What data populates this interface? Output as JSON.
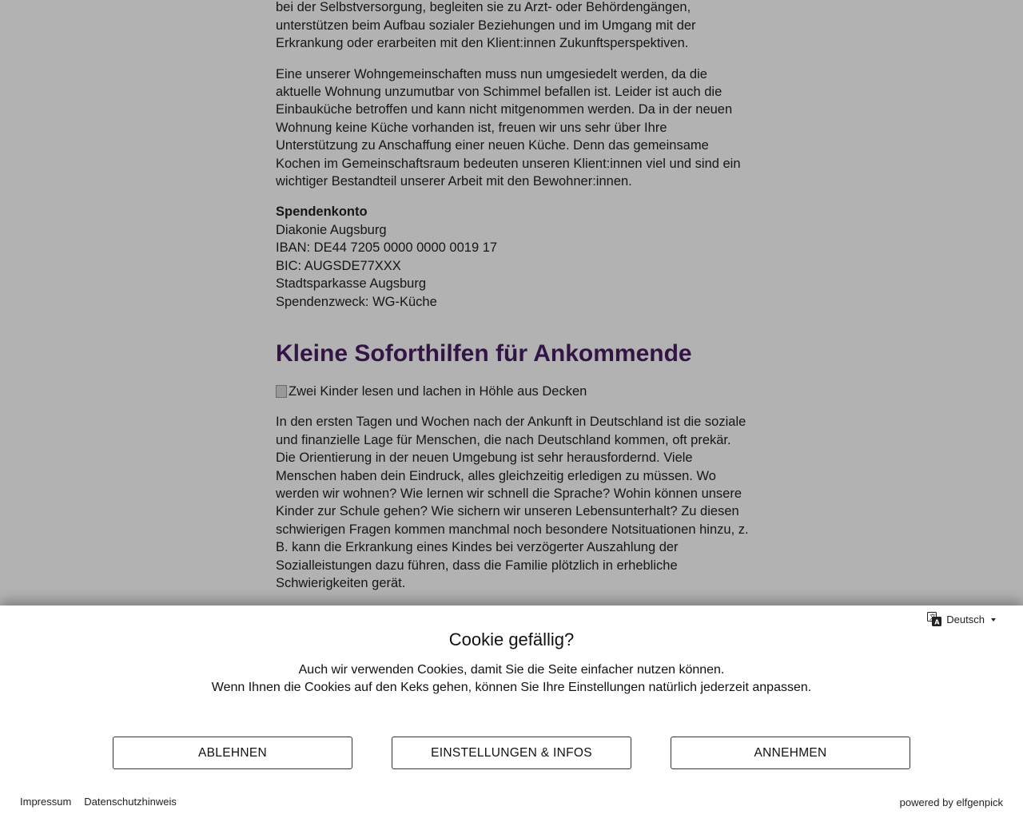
{
  "article": {
    "para1": "Bewältigung ihres Alltags benötigen. Aufsuchende Fachkräfte helfen ihnen etwa bei der Selbstversorgung, begleiten sie zu Arzt- oder Behördengängen, unterstützen beim Aufbau sozialer Beziehungen und im Umgang mit der Erkrankung oder erarbeiten mit den Klient:innen Zukunftsperspektiven.",
    "para2": "Eine unserer Wohngemeinschaften muss nun umgesiedelt werden, da die aktuelle Wohnung unzumutbar von Schimmel befallen ist. Leider ist auch die Einbauküche betroffen und kann nicht mitgenommen werden. Da in der neuen Wohnung keine Küche vorhanden ist, freuen wir uns sehr über Ihre Unterstützung zu Anschaffung einer neuen Küche. Denn das gemeinsame Kochen im Gemeinschaftsraum bedeuten unseren Klient:innen viel und sind ein wichtiger Bestandteil unserer Arbeit mit den Bewohner:innen.",
    "donation": {
      "title": "Spendenkonto",
      "org": "Diakonie Augsburg",
      "iban": "IBAN: DE44 7205 0000 0000 0019 17",
      "bic": "BIC: AUGSDE77XXX",
      "bank": "Stadtsparkasse Augsburg",
      "purpose": "Spendenzweck: WG-Küche"
    },
    "heading2": "Kleine Soforthilfen für Ankommende",
    "image_alt": "Zwei Kinder lesen und lachen in Höhle aus Decken",
    "para3": "In den ersten Tagen und Wochen nach der Ankunft in Deutschland ist die soziale und finanzielle Lage für Menschen, die nach Deutschland kommen, oft prekär. Die Orientierung in der neuen Umgebung ist sehr herausfordernd. Viele Menschen haben dein Eindruck, alles gleichzeitig erledigen zu müssen. Wo werden wir wohnen? Wie lernen wir schnell die Sprache? Wohin können unsere Kinder zur Schule gehen? Wie sichern wir unseren Lebensunterhalt? Zu diesen schwierigen Fragen kommen manchmal noch besondere Notsituationen hinzu, z. B. kann die Erkrankung eines Kindes bei verzögerter Auszahlung der Sozialleistungen dazu führen, dass die Familie plötzlich in erhebliche Schwierigkeiten gerät."
  },
  "cookie": {
    "language": "Deutsch",
    "language_icon": "translate-icon",
    "title": "Cookie gefällig?",
    "text_line1": "Auch wir verwenden Cookies, damit Sie die Seite einfacher nutzen können.",
    "text_line2": "Wenn Ihnen die Cookies auf den Keks gehen, können Sie Ihre Einstellungen natürlich jederzeit anpassen.",
    "decline_label": "ABLEHNEN",
    "settings_label": "EINSTELLUNGEN & INFOS",
    "accept_label": "ANNEHMEN",
    "imprint_label": "Impressum",
    "privacy_label": "Datenschutzhinweis",
    "powered_by": "powered by elfgenpick"
  },
  "colors": {
    "heading": "#4a1f63",
    "overlay": "rgba(0,0,0,0.30)"
  }
}
